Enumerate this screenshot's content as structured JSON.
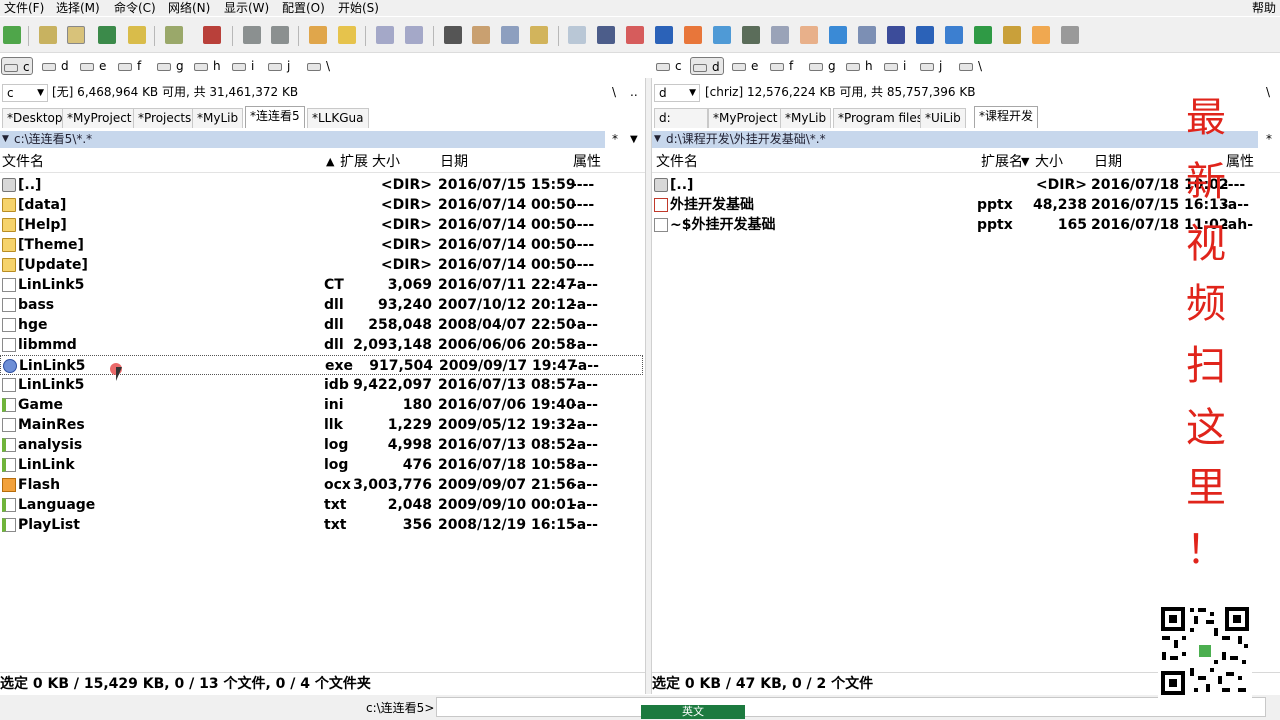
{
  "menu": [
    "文件(F)",
    "选择(M)",
    "命令(C)",
    "网络(N)",
    "显示(W)",
    "配置(O)",
    "开始(S)",
    "帮助"
  ],
  "left": {
    "drives": [
      "c",
      "d",
      "e",
      "f",
      "g",
      "h",
      "i",
      "j",
      "\\"
    ],
    "selected_drive": "c",
    "drive_combo": "c",
    "drive_info": "[无]  6,468,964 KB 可用, 共 31,461,372 KB",
    "root_btn": "\\",
    "up_btn": "..",
    "tabs": [
      "*Desktop",
      "*MyProject",
      "*Projects",
      "*MyLib",
      "*连连看5",
      "*LLKGua"
    ],
    "active_tab": 4,
    "path": "c:\\连连看5\\*.*",
    "path_star": "*",
    "columns": {
      "name": "文件名",
      "ext": "扩展",
      "size": "大小",
      "date": "日期",
      "attr": "属性"
    },
    "files": [
      {
        "name": "[..]",
        "ext": "",
        "size": "<DIR>",
        "date": "2016/07/15 15:59",
        "attr": "----",
        "icon": "up-icon"
      },
      {
        "name": "[data]",
        "ext": "",
        "size": "<DIR>",
        "date": "2016/07/14 00:50",
        "attr": "----",
        "icon": "folder-icon"
      },
      {
        "name": "[Help]",
        "ext": "",
        "size": "<DIR>",
        "date": "2016/07/14 00:50",
        "attr": "----",
        "icon": "folder-icon"
      },
      {
        "name": "[Theme]",
        "ext": "",
        "size": "<DIR>",
        "date": "2016/07/14 00:50",
        "attr": "----",
        "icon": "folder-icon"
      },
      {
        "name": "[Update]",
        "ext": "",
        "size": "<DIR>",
        "date": "2016/07/14 00:50",
        "attr": "----",
        "icon": "folder-icon"
      },
      {
        "name": "LinLink5",
        "ext": "CT",
        "size": "3,069",
        "date": "2016/07/11 22:47",
        "attr": "-a--",
        "icon": "file-icon"
      },
      {
        "name": "bass",
        "ext": "dll",
        "size": "93,240",
        "date": "2007/10/12 20:12",
        "attr": "-a--",
        "icon": "dll-icon"
      },
      {
        "name": "hge",
        "ext": "dll",
        "size": "258,048",
        "date": "2008/04/07 22:50",
        "attr": "-a--",
        "icon": "dll-icon"
      },
      {
        "name": "libmmd",
        "ext": "dll",
        "size": "2,093,148",
        "date": "2006/06/06 20:58",
        "attr": "-a--",
        "icon": "dll-icon"
      },
      {
        "name": "LinLink5",
        "ext": "exe",
        "size": "917,504",
        "date": "2009/09/17 19:47",
        "attr": "-a--",
        "icon": "exe-icon"
      },
      {
        "name": "LinLink5",
        "ext": "idb",
        "size": "9,422,097",
        "date": "2016/07/13 08:57",
        "attr": "-a--",
        "icon": "file-icon"
      },
      {
        "name": "Game",
        "ext": "ini",
        "size": "180",
        "date": "2016/07/06 19:40",
        "attr": "-a--",
        "icon": "ini-icon"
      },
      {
        "name": "MainRes",
        "ext": "llk",
        "size": "1,229",
        "date": "2009/05/12 19:32",
        "attr": "-a--",
        "icon": "file-icon"
      },
      {
        "name": "analysis",
        "ext": "log",
        "size": "4,998",
        "date": "2016/07/13 08:52",
        "attr": "-a--",
        "icon": "ini-icon"
      },
      {
        "name": "LinLink",
        "ext": "log",
        "size": "476",
        "date": "2016/07/18 10:58",
        "attr": "-a--",
        "icon": "ini-icon"
      },
      {
        "name": "Flash",
        "ext": "ocx",
        "size": "3,003,776",
        "date": "2009/09/07 21:56",
        "attr": "-a--",
        "icon": "ocx-icon"
      },
      {
        "name": "Language",
        "ext": "txt",
        "size": "2,048",
        "date": "2009/09/10 00:01",
        "attr": "-a--",
        "icon": "ini-icon"
      },
      {
        "name": "PlayList",
        "ext": "txt",
        "size": "356",
        "date": "2008/12/19 16:15",
        "attr": "-a--",
        "icon": "ini-icon"
      }
    ],
    "status": "选定 0 KB / 15,429 KB, 0 / 13 个文件, 0 / 4 个文件夹"
  },
  "right": {
    "drives": [
      "c",
      "d",
      "e",
      "f",
      "g",
      "h",
      "i",
      "j",
      "\\"
    ],
    "selected_drive": "d",
    "drive_combo": "d",
    "drive_info": "[chriz]  12,576,224 KB 可用, 共 85,757,396 KB",
    "root_btn": "\\",
    "tabs": [
      "d:",
      "*MyProject",
      "*MyLib",
      "*Program files",
      "*UiLib",
      "*课程开发"
    ],
    "active_tab": 5,
    "path": "d:\\课程开发\\外挂开发基础\\*.*",
    "path_star": "*",
    "columns": {
      "name": "文件名",
      "ext": "扩展名",
      "size": "大小",
      "date": "日期",
      "attr": "属性"
    },
    "files": [
      {
        "name": "[..]",
        "ext": "",
        "size": "<DIR>",
        "date": "2016/07/18 10:02",
        "attr": "----",
        "icon": "up-icon"
      },
      {
        "name": "外挂开发基础",
        "ext": "pptx",
        "size": "48,238",
        "date": "2016/07/15 16:13",
        "attr": "-a--",
        "icon": "pptx-icon"
      },
      {
        "name": "~$外挂开发基础",
        "ext": "pptx",
        "size": "165",
        "date": "2016/07/18 11:02",
        "attr": "-ah-",
        "icon": "file-icon"
      }
    ],
    "status": "选定 0 KB / 47 KB, 0 / 2 个文件"
  },
  "command_path": "c:\\连连看5>",
  "ime": {
    "mode": "英文"
  },
  "overlay_text": [
    "最",
    "新",
    "视",
    "频",
    "扫",
    "这",
    "里",
    "！"
  ],
  "colors": {
    "path_bg": "#c7d7ec",
    "overlay": "#e0241b",
    "taskbar": "#1c7a3f"
  }
}
